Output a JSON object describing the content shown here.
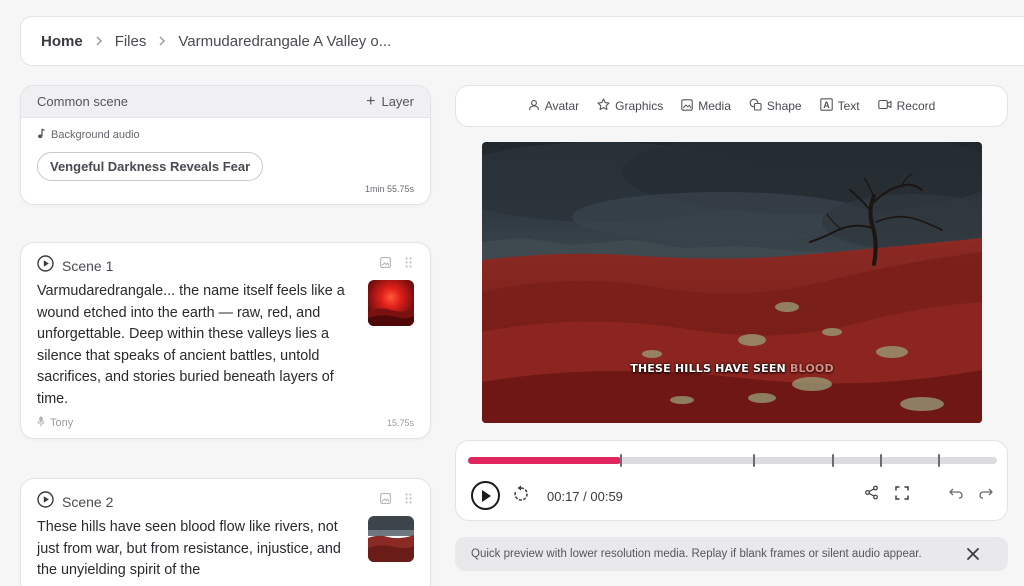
{
  "breadcrumb": {
    "home": "Home",
    "files": "Files",
    "current": "Varmudaredrangale A Valley o..."
  },
  "common_scene": {
    "title": "Common scene",
    "add_layer_label": "Layer",
    "background_audio_label": "Background audio",
    "audio_track": "Vengeful Darkness Reveals Fear",
    "duration": "1min 55.75s"
  },
  "scenes": [
    {
      "title": "Scene 1",
      "text": "Varmudaredrangale... the name itself feels like a wound etched into the earth — raw, red, and unforgettable. Deep within these valleys lies a silence that speaks of ancient battles, untold sacrifices, and stories buried beneath layers of time.",
      "narrator": "Tony",
      "duration": "15.75s"
    },
    {
      "title": "Scene 2",
      "text": "These hills have seen blood flow like rivers, not just from war, but from resistance, injustice, and the unyielding spirit of the"
    }
  ],
  "toolbar": {
    "avatar": "Avatar",
    "graphics": "Graphics",
    "media": "Media",
    "shape": "Shape",
    "text": "Text",
    "record": "Record"
  },
  "preview": {
    "caption_main": "THESE HILLS HAVE SEEN",
    "caption_dim": "BLOOD"
  },
  "player": {
    "current_time": "00:17",
    "total_time": "00:59",
    "time_display": "00:17 / 00:59",
    "progress": 0.29,
    "scene_markers": [
      0.29,
      0.54,
      0.69,
      0.78,
      0.89
    ]
  },
  "notice": {
    "text": "Quick preview with lower resolution media. Replay if blank frames or silent audio appear."
  },
  "colors": {
    "accent": "#e0245e",
    "background": "#f6f6f7",
    "card": "#ffffff"
  }
}
